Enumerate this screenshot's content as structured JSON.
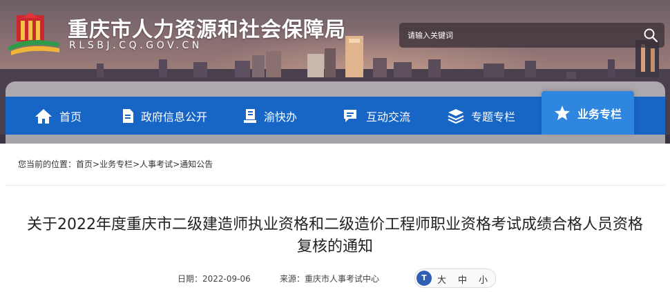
{
  "header": {
    "site_title": "重庆市人力资源和社会保障局",
    "site_domain": "RLSBJ.CQ.GOV.CN",
    "search": {
      "placeholder": "请输入关键词"
    }
  },
  "nav": {
    "items": [
      {
        "label": "首页",
        "icon": "home-icon"
      },
      {
        "label": "政府信息公开",
        "icon": "document-icon"
      },
      {
        "label": "渝快办",
        "icon": "service-icon"
      },
      {
        "label": "互动交流",
        "icon": "chat-icon"
      },
      {
        "label": "专题专栏",
        "icon": "layers-icon"
      },
      {
        "label": "业务专栏",
        "icon": "star-icon",
        "active": true
      }
    ]
  },
  "breadcrumb": {
    "prefix": "您当前的位置：",
    "items": [
      "首页",
      "业务专栏",
      "人事考试",
      "通知公告"
    ],
    "separator": ">"
  },
  "article": {
    "title": "关于2022年度重庆市二级建造师执业资格和二级造价工程师职业资格考试成绩合格人员资格复核的通知",
    "date_label": "日期：",
    "date": "2022-09-06",
    "source_label": "来源：",
    "source": "重庆市人事考试中心",
    "font_size": {
      "icon_text": "T",
      "options": [
        "大",
        "中",
        "小"
      ]
    }
  },
  "colors": {
    "nav_bg": "#1766c6",
    "nav_active_bg": "#2f86df",
    "text": "#222222"
  }
}
